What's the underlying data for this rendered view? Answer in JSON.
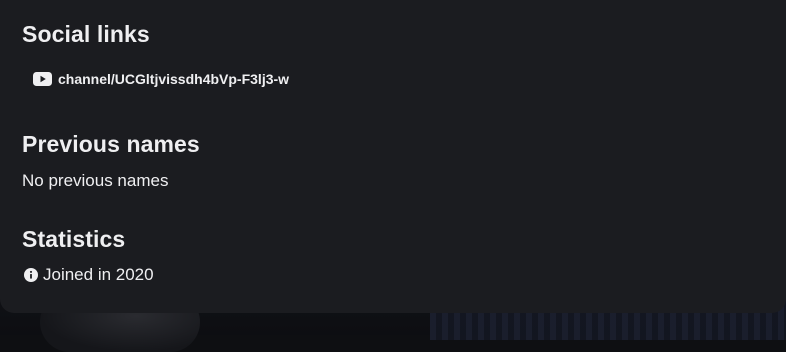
{
  "social": {
    "title": "Social links",
    "links": [
      {
        "icon": "youtube-icon",
        "text": "channel/UCGltjvissdh4bVp-F3lj3-w"
      }
    ]
  },
  "previous_names": {
    "title": "Previous names",
    "empty_text": "No previous names"
  },
  "statistics": {
    "title": "Statistics",
    "items": [
      {
        "icon": "info-icon",
        "text": "Joined in 2020"
      }
    ]
  },
  "colors": {
    "panel": "#1b1c20",
    "text": "#efeff1",
    "background": "#0e0f12"
  }
}
